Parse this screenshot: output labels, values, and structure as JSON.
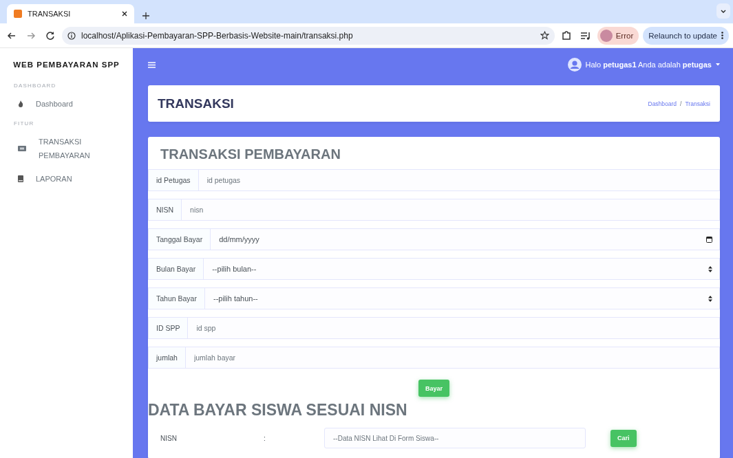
{
  "browser": {
    "tab_title": "TRANSAKSI",
    "url": "localhost/Aplikasi-Pembayaran-SPP-Berbasis-Website-main/transaksi.php",
    "profile_label": "Error",
    "update_button": "Relaunch to update"
  },
  "sidebar": {
    "brand": "WEB PEMBAYARAN SPP",
    "sections": [
      {
        "title": "DASHBOARD",
        "items": [
          {
            "label": "Dashboard"
          }
        ]
      },
      {
        "title": "FITUR",
        "items": [
          {
            "label": "TRANSAKSI PEMBAYARAN"
          },
          {
            "label": "LAPORAN"
          }
        ]
      }
    ]
  },
  "navbar": {
    "greeting": "Halo **petugas1** Anda adalah **petugas**"
  },
  "header": {
    "title": "TRANSAKSI",
    "breadcrumb": [
      "Dashboard",
      "Transaksi"
    ],
    "separator": "/"
  },
  "form": {
    "title": "TRANSAKSI PEMBAYARAN",
    "fields": [
      {
        "kind": "text",
        "label": "id Petugas",
        "placeholder": "id petugas"
      },
      {
        "kind": "text",
        "label": "NISN",
        "placeholder": "nisn"
      },
      {
        "kind": "date",
        "label": "Tanggal Bayar",
        "value": "dd/mm/yyyy"
      },
      {
        "kind": "select",
        "label": "Bulan Bayar",
        "value": "--pilih bulan--"
      },
      {
        "kind": "select",
        "label": "Tahun Bayar",
        "value": "--pilih tahun--"
      },
      {
        "kind": "text",
        "label": "ID SPP",
        "placeholder": "id spp"
      },
      {
        "kind": "text",
        "label": "jumlah",
        "placeholder": "jumlah bayar"
      }
    ],
    "submit": "Bayar"
  },
  "search": {
    "title": "DATA BAYAR SISWA SESUAI NISN",
    "label": "NISN",
    "colon": ":",
    "placeholder": "--Data NISN Lihat Di Form Siswa--",
    "button": "Cari"
  }
}
